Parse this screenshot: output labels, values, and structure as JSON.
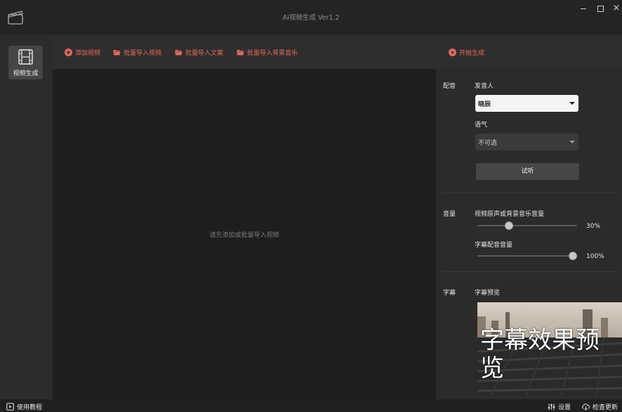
{
  "window": {
    "title": "AI视频生成 Ver1.2"
  },
  "sidebar": {
    "items": [
      {
        "label": "视频生成",
        "icon": "film-icon"
      }
    ]
  },
  "toolbar": {
    "add_video": "添加视频",
    "batch_import_video": "批量导入视频",
    "batch_import_text": "批量导入文案",
    "batch_import_bgm": "批量导入背景音乐",
    "start": "开始生成",
    "accent_color": "#e7685f"
  },
  "main": {
    "placeholder": "请先添加或批量导入视频"
  },
  "panel": {
    "dubbing": {
      "section_label": "配音",
      "voice_label": "发音人",
      "voice_value": "晓辰",
      "tone_label": "语气",
      "tone_value": "不可选",
      "audition_label": "试听"
    },
    "volume": {
      "section_label": "音量",
      "bgm_label": "视频原声或背景音乐音量",
      "bgm_value": "30%",
      "bgm_level": 0.3,
      "dub_label": "字幕配音音量",
      "dub_value": "100%",
      "dub_level": 1.0
    },
    "subtitle": {
      "section_label": "字幕",
      "preview_label": "字幕预览",
      "preview_text": "字幕效果预览"
    }
  },
  "statusbar": {
    "tutorial": "使用教程",
    "settings": "设置",
    "check_update": "检查更新"
  }
}
